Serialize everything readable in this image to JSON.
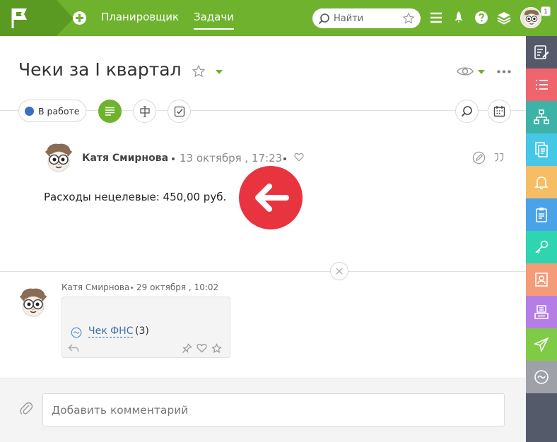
{
  "topbar": {
    "nav": [
      {
        "label": "Планировщик",
        "active": false
      },
      {
        "label": "Задачи",
        "active": true
      }
    ],
    "search_placeholder": "Найти",
    "notification_count": "1",
    "brand_color": "#6eb22e"
  },
  "rightbar": {
    "items": [
      {
        "icon": "edit-note-icon",
        "color": "#555a6b"
      },
      {
        "icon": "list-icon",
        "color": "#f0656d"
      },
      {
        "icon": "hierarchy-icon",
        "color": "#3cb3a6"
      },
      {
        "icon": "documents-icon",
        "color": "#47c7e8"
      },
      {
        "icon": "bell-icon",
        "color": "#f5bd64"
      },
      {
        "icon": "clipboard-icon",
        "color": "#4aa2e8"
      },
      {
        "icon": "key-icon",
        "color": "#2ed5b0"
      },
      {
        "icon": "contact-card-icon",
        "color": "#f49b79"
      },
      {
        "icon": "inbox-tray-icon",
        "color": "#b57ee6"
      },
      {
        "icon": "paper-plane-icon",
        "color": "#7fcb48"
      },
      {
        "icon": "tilde-circle-icon",
        "color": "#9ea1a7"
      }
    ]
  },
  "task": {
    "title": "Чеки за I квартал",
    "status": "В работе",
    "status_color": "#3d6fc0"
  },
  "message": {
    "author": "Катя Смирнова",
    "date": "13 октября , 17:23",
    "text": "Расходы нецелевые: 450,00 руб.",
    "arrow_color": "#e8343f"
  },
  "comment": {
    "author": "Катя Смирнова",
    "date": "29 октября , 10:02",
    "attachment": {
      "link_text": "Чек ФНС",
      "count": "(3)"
    }
  },
  "composer": {
    "placeholder": "Добавить комментарий"
  }
}
